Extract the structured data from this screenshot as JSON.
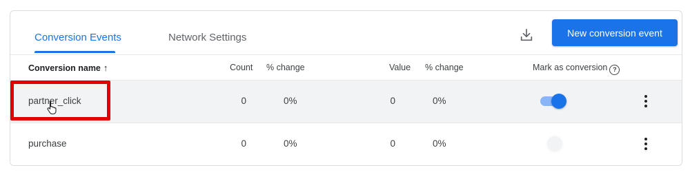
{
  "tabs": [
    {
      "label": "Conversion Events",
      "active": true
    },
    {
      "label": "Network Settings",
      "active": false
    }
  ],
  "toolbar": {
    "download_icon": "download-icon",
    "new_button_label": "New conversion event"
  },
  "columns": {
    "name": "Conversion name",
    "name_sort_icon": "arrow-up-icon",
    "count": "Count",
    "count_change": "% change",
    "value": "Value",
    "value_change": "% change",
    "mark": "Mark as conversion",
    "mark_help_icon": "help-icon"
  },
  "rows": [
    {
      "name": "partner_click",
      "count": "0",
      "count_change": "0%",
      "value": "0",
      "value_change": "0%",
      "marked": true,
      "highlighted": true
    },
    {
      "name": "purchase",
      "count": "0",
      "count_change": "0%",
      "value": "0",
      "value_change": "0%",
      "marked": false,
      "highlighted": false
    }
  ],
  "colors": {
    "accent": "#1a73e8",
    "highlight_border": "#e00000",
    "row_hover": "#f1f3f4"
  }
}
